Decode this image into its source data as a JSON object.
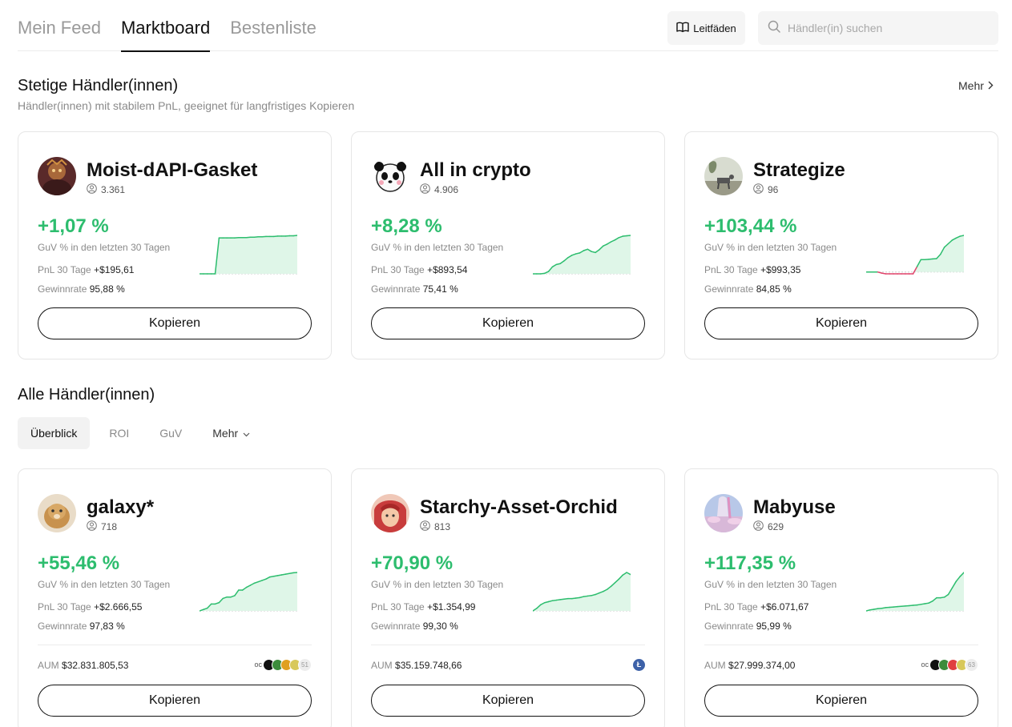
{
  "nav": {
    "tabs": [
      "Mein Feed",
      "Marktboard",
      "Bestenliste"
    ],
    "active_tab": "Marktboard",
    "guide_label": "Leitfäden",
    "search_placeholder": "Händler(in) suchen"
  },
  "steady": {
    "title": "Stetige Händler(innen)",
    "subtitle": "Händler(innen) mit stabilem PnL, geeignet für langfristiges Kopieren",
    "more_label": "Mehr",
    "traders": [
      {
        "name": "Moist-dAPI-Gasket",
        "followers": "3.361",
        "roi": "+1,07 %",
        "roi_label": "GuV % in den letzten 30 Tagen",
        "pnl_label": "PnL 30 Tage",
        "pnl": "+$195,61",
        "winrate_label": "Gewinnrate",
        "winrate": "95,88 %",
        "copy_label": "Kopieren",
        "trend": [
          0.0,
          0.0,
          0.0,
          0.0,
          0.0,
          1.0,
          1.0,
          1.0,
          1.0,
          1.0,
          1.01,
          1.01,
          1.01,
          1.02,
          1.02,
          1.03,
          1.03,
          1.04,
          1.04,
          1.04,
          1.05,
          1.05,
          1.05,
          1.06,
          1.06,
          1.07
        ]
      },
      {
        "name": "All in crypto",
        "followers": "4.906",
        "roi": "+8,28 %",
        "roi_label": "GuV % in den letzten 30 Tagen",
        "pnl_label": "PnL 30 Tage",
        "pnl": "+$893,54",
        "winrate_label": "Gewinnrate",
        "winrate": "75,41 %",
        "copy_label": "Kopieren",
        "trend": [
          0.0,
          0.0,
          0.0,
          0.1,
          0.5,
          1.5,
          2.0,
          2.2,
          2.8,
          3.5,
          4.0,
          4.3,
          4.5,
          5.0,
          5.3,
          4.8,
          4.6,
          5.2,
          6.0,
          6.4,
          6.9,
          7.3,
          7.8,
          8.1,
          8.2,
          8.28
        ]
      },
      {
        "name": "Strategize",
        "followers": "96",
        "roi": "+103,44 %",
        "roi_label": "GuV % in den letzten 30 Tagen",
        "pnl_label": "PnL 30 Tage",
        "pnl": "+$993,35",
        "winrate_label": "Gewinnrate",
        "winrate": "84,85 %",
        "copy_label": "Kopieren",
        "trend": [
          0,
          0,
          0,
          0,
          -3,
          -5,
          -5,
          -5,
          -5,
          -5,
          -5,
          -5,
          -5,
          15,
          35,
          35,
          36,
          37,
          38,
          50,
          70,
          80,
          90,
          96,
          101,
          103.44
        ]
      }
    ]
  },
  "all": {
    "title": "Alle Händler(innen)",
    "filters": [
      "Überblick",
      "ROI",
      "GuV",
      "Mehr"
    ],
    "active_filter": "Überblick",
    "traders": [
      {
        "name": "galaxy*",
        "followers": "718",
        "roi": "+55,46 %",
        "roi_label": "GuV % in den letzten 30 Tagen",
        "pnl_label": "PnL 30 Tage",
        "pnl": "+$2.666,55",
        "winrate_label": "Gewinnrate",
        "winrate": "97,83 %",
        "aum_label": "AUM",
        "aum": "$32.831.805,53",
        "coin_count": "51",
        "coin_prefix": "oc",
        "coins": [
          "#111111",
          "#3c8c3c",
          "#e0a020",
          "#d8c85a"
        ],
        "copy_label": "Kopieren",
        "trend": [
          0,
          2,
          4,
          10,
          10,
          12,
          18,
          20,
          20,
          22,
          30,
          30,
          34,
          37,
          40,
          42,
          44,
          46,
          49,
          50,
          51,
          52,
          53,
          54,
          55,
          55.46
        ]
      },
      {
        "name": "Starchy-Asset-Orchid",
        "followers": "813",
        "roi": "+70,90 %",
        "roi_label": "GuV % in den letzten 30 Tagen",
        "pnl_label": "PnL 30 Tage",
        "pnl": "+$1.354,99",
        "winrate_label": "Gewinnrate",
        "winrate": "99,30 %",
        "aum_label": "AUM",
        "aum": "$35.159.748,66",
        "coin_count": "",
        "coin_symbol": "Ł",
        "copy_label": "Kopieren",
        "trend": [
          0,
          5,
          12,
          16,
          18,
          20,
          21,
          22,
          23,
          24,
          24,
          25,
          26,
          28,
          29,
          30,
          32,
          35,
          38,
          42,
          48,
          55,
          62,
          70,
          75,
          70.9
        ]
      },
      {
        "name": "Mabyuse",
        "followers": "629",
        "roi": "+117,35 %",
        "roi_label": "GuV % in den letzten 30 Tagen",
        "pnl_label": "PnL 30 Tage",
        "pnl": "+$6.071,67",
        "winrate_label": "Gewinnrate",
        "winrate": "95,99 %",
        "aum_label": "AUM",
        "aum": "$27.999.374,00",
        "coin_count": "63",
        "coin_prefix": "oc",
        "coins": [
          "#111111",
          "#3c8c3c",
          "#e04040",
          "#d8c85a"
        ],
        "copy_label": "Kopieren",
        "trend": [
          0,
          3,
          5,
          7,
          8,
          10,
          11,
          12,
          13,
          14,
          15,
          16,
          17,
          18,
          20,
          22,
          24,
          30,
          40,
          40,
          42,
          50,
          70,
          90,
          105,
          117.35
        ]
      }
    ]
  },
  "colors": {
    "positive": "#2dbd6e",
    "negative": "#e0436b",
    "area_fill": "#dff6e8"
  }
}
